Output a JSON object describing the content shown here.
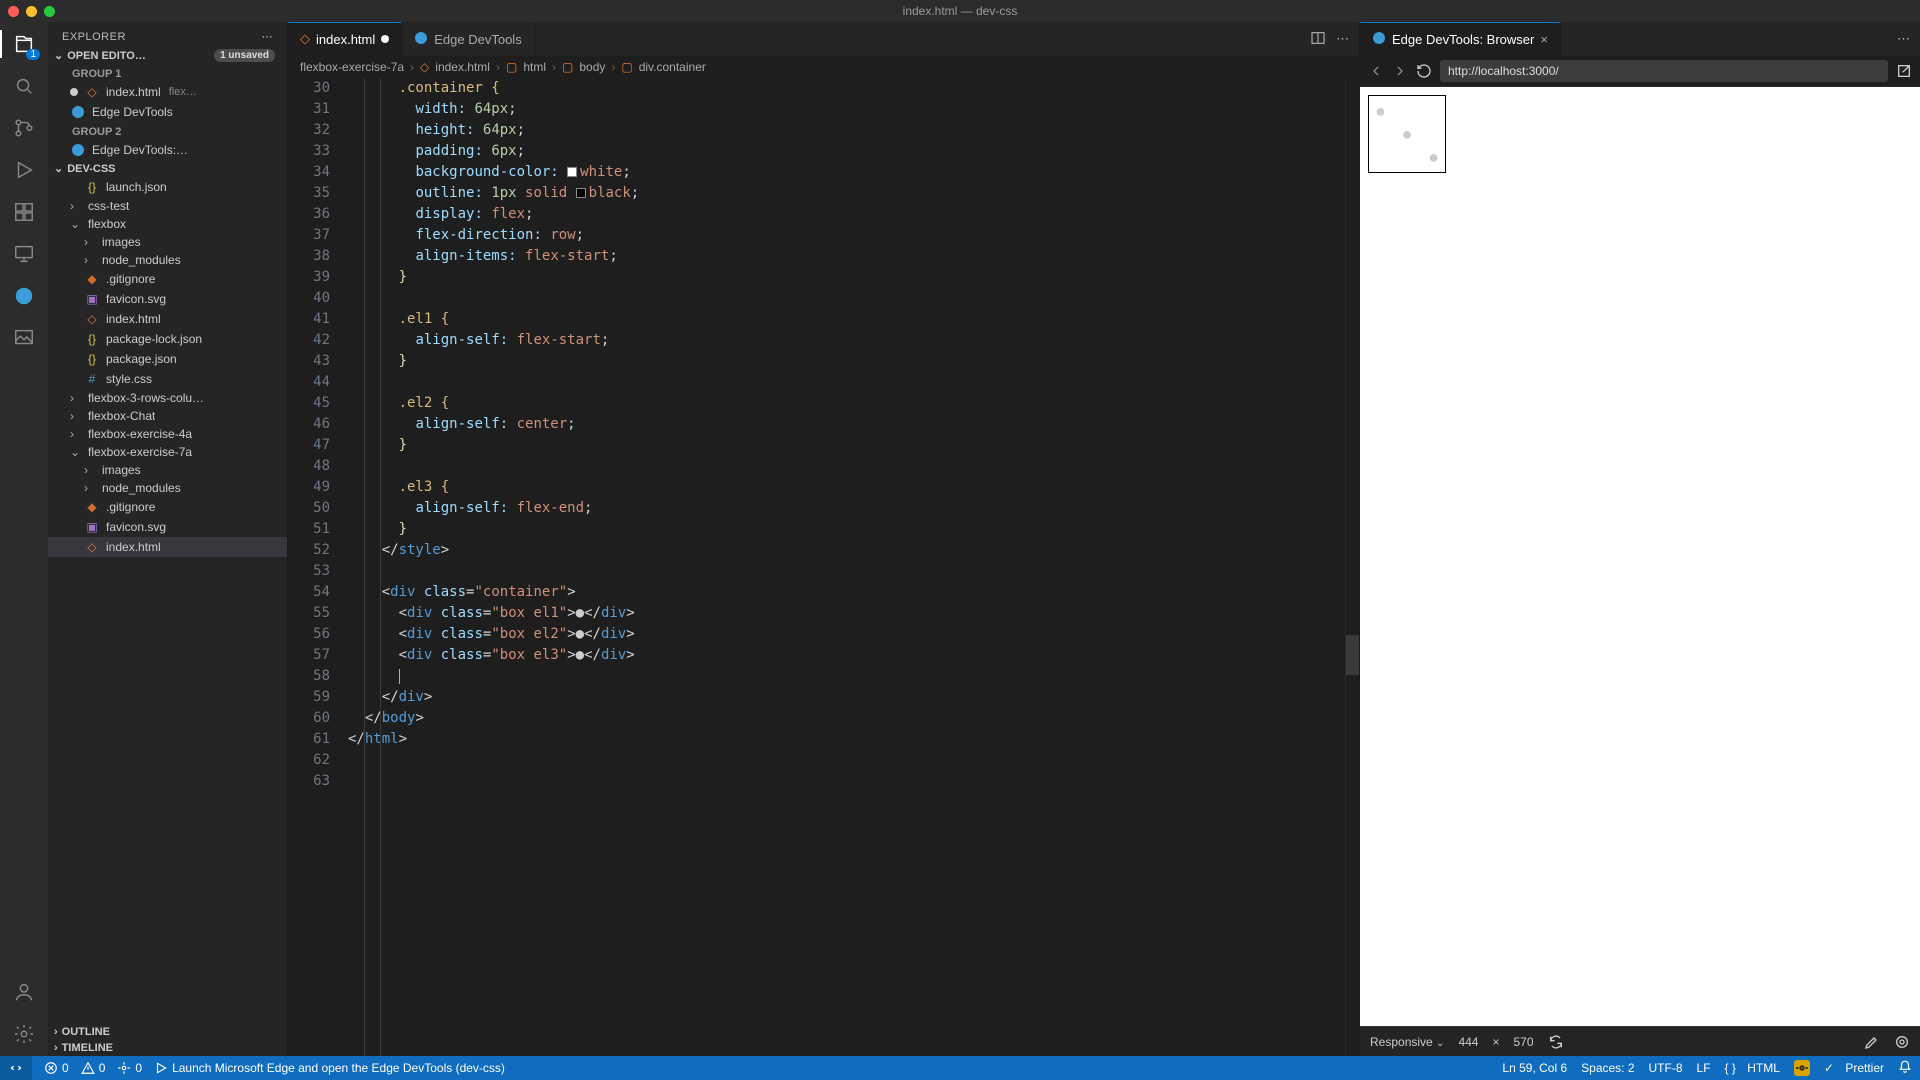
{
  "window": {
    "title": "index.html — dev-css"
  },
  "explorer": {
    "title": "EXPLORER",
    "openEditors": {
      "label": "OPEN EDITO…",
      "badge": "1 unsaved"
    },
    "group1": "GROUP 1",
    "group2": "GROUP 2",
    "oe1": {
      "name": "index.html",
      "desc": "flex…"
    },
    "oe2": {
      "name": "Edge DevTools"
    },
    "oe3": {
      "name": "Edge DevTools:…"
    },
    "project": "DEV-CSS",
    "items": {
      "launch": "launch.json",
      "csstest": "css-test",
      "flexbox": "flexbox",
      "images": "images",
      "node": "node_modules",
      "gitignore": ".gitignore",
      "favicon": "favicon.svg",
      "index": "index.html",
      "pkglock": "package-lock.json",
      "pkg": "package.json",
      "style": "style.css",
      "fb3": "flexbox-3-rows-colu…",
      "fbchat": "flexbox-Chat",
      "fb4a": "flexbox-exercise-4a",
      "fb7a": "flexbox-exercise-7a",
      "images2": "images",
      "node2": "node_modules",
      "gitignore2": ".gitignore",
      "favicon2": "favicon.svg",
      "index2": "index.html"
    },
    "outline": "OUTLINE",
    "timeline": "TIMELINE"
  },
  "tabs": {
    "t1": "index.html",
    "t2": "Edge DevTools",
    "t3": "Edge DevTools: Browser"
  },
  "crumbs": {
    "c1": "flexbox-exercise-7a",
    "c2": "index.html",
    "c3": "html",
    "c4": "body",
    "c5": "div.container"
  },
  "code": {
    "l30": ".container {",
    "l31a": "width:",
    "l31b": "64px",
    "l32a": "height:",
    "l32b": "64px",
    "l33a": "padding:",
    "l33b": "6px",
    "l34a": "background-color:",
    "l34b": "white",
    "l35a": "outline:",
    "l35b": "1px",
    "l35c": "solid",
    "l35d": "black",
    "l36a": "display:",
    "l36b": "flex",
    "l37a": "flex-direction:",
    "l37b": "row",
    "l38a": "align-items:",
    "l38b": "flex-start",
    "l42": ".el1 {",
    "l43a": "align-self:",
    "l43b": "flex-start",
    "l46": ".el2 {",
    "l47a": "align-self:",
    "l47b": "center",
    "l50": ".el3 {",
    "l51a": "align-self:",
    "l51b": "flex-end",
    "l53": "style",
    "l55t": "div",
    "l55a": "class",
    "l55v": "\"container\"",
    "l56v": "\"box el1\"",
    "l57v": "\"box el2\"",
    "l58v": "\"box el3\"",
    "l61": "body",
    "l62": "html"
  },
  "activityBadge": "1",
  "browser": {
    "url": "http://localhost:3000/"
  },
  "devbar": {
    "mode": "Responsive",
    "w": "444",
    "h": "570"
  },
  "status": {
    "err": "0",
    "warn": "0",
    "port": "0",
    "launch": "Launch Microsoft Edge and open the Edge DevTools (dev-css)",
    "pos": "Ln 59, Col 6",
    "spaces": "Spaces: 2",
    "enc": "UTF-8",
    "eol": "LF",
    "lang": "HTML",
    "prettier": "Prettier"
  },
  "chart_data": null
}
